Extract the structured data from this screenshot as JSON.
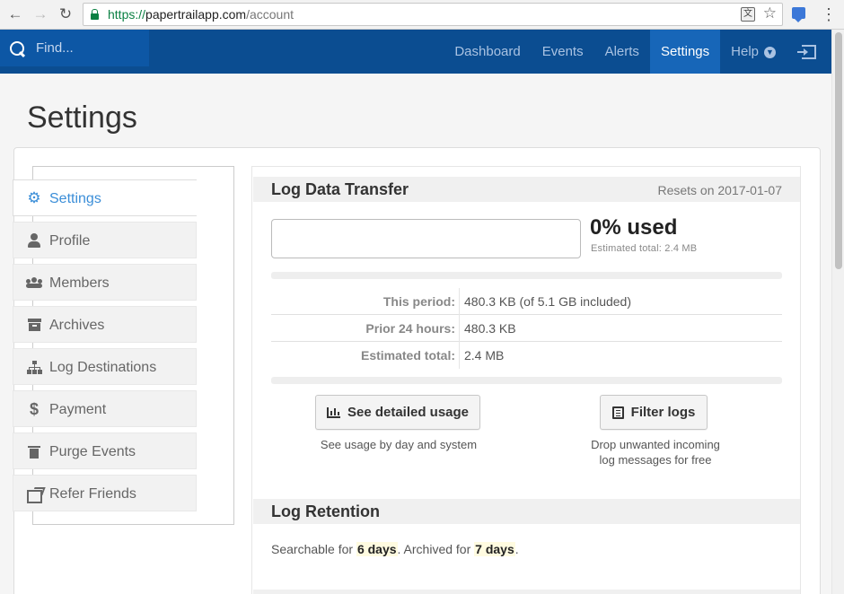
{
  "browser": {
    "url_scheme": "https://",
    "url_host": "papertrailapp.com",
    "url_path": "/account"
  },
  "header": {
    "search_placeholder": "Find...",
    "nav": [
      {
        "label": "Dashboard",
        "active": false
      },
      {
        "label": "Events",
        "active": false
      },
      {
        "label": "Alerts",
        "active": false
      },
      {
        "label": "Settings",
        "active": true
      },
      {
        "label": "Help",
        "active": false
      }
    ]
  },
  "page": {
    "title": "Settings"
  },
  "sidebar": {
    "items": [
      {
        "label": "Settings",
        "icon": "gear-icon",
        "active": true
      },
      {
        "label": "Profile",
        "icon": "user-icon",
        "active": false
      },
      {
        "label": "Members",
        "icon": "users-icon",
        "active": false
      },
      {
        "label": "Archives",
        "icon": "archive-icon",
        "active": false
      },
      {
        "label": "Log Destinations",
        "icon": "sitemap-icon",
        "active": false
      },
      {
        "label": "Payment",
        "icon": "dollar-icon",
        "active": false
      },
      {
        "label": "Purge Events",
        "icon": "trash-icon",
        "active": false
      },
      {
        "label": "Refer Friends",
        "icon": "share-icon",
        "active": false
      }
    ]
  },
  "log_transfer": {
    "title": "Log Data Transfer",
    "resets": "Resets on 2017-01-07",
    "used_fraction": 0.0,
    "used_label": "0% used",
    "estimated_small": "Estimated total: 2.4 MB",
    "rows": [
      {
        "key": "This period:",
        "value": "480.3 KB (of 5.1 GB included)"
      },
      {
        "key": "Prior 24 hours:",
        "value": "480.3 KB"
      },
      {
        "key": "Estimated total:",
        "value": "2.4 MB"
      }
    ],
    "usage_button": "See detailed usage",
    "usage_caption": "See usage by day and system",
    "filter_button": "Filter logs",
    "filter_caption_1": "Drop unwanted incoming",
    "filter_caption_2": "log messages for free"
  },
  "log_retention": {
    "title": "Log Retention",
    "prefix": "Searchable for ",
    "searchable": "6 days",
    "middle": ". Archived for ",
    "archived": "7 days",
    "suffix": "."
  },
  "colors": {
    "header_bg": "#0b4d91",
    "active_nav": "#1766b8",
    "accent": "#3b8ed8"
  }
}
